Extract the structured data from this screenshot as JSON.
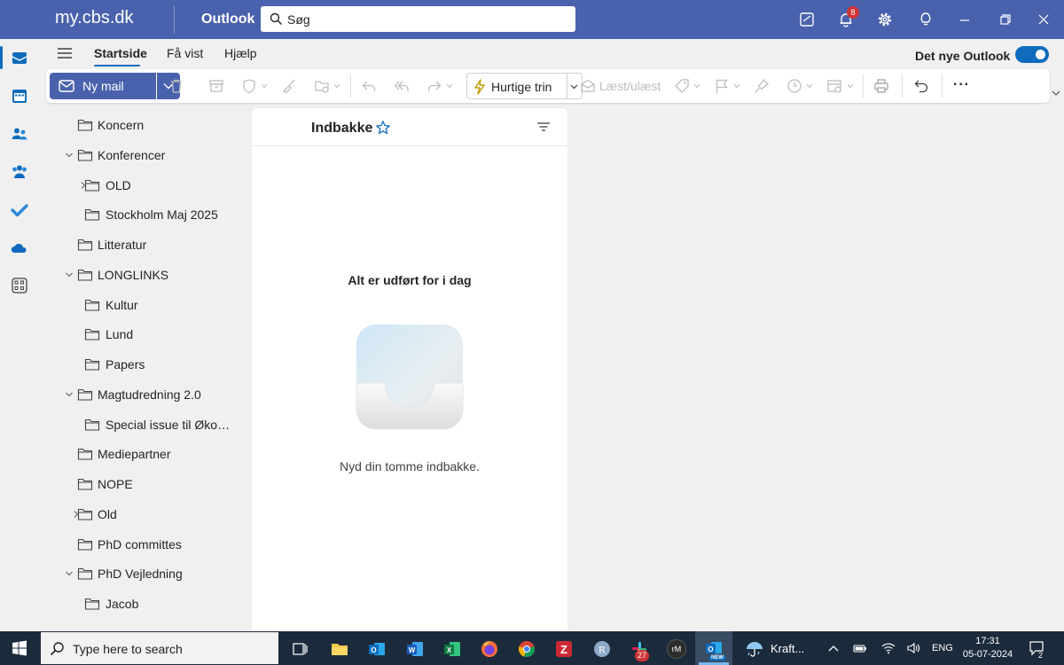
{
  "titlebar": {
    "brand": "my.cbs.dk",
    "app_name": "Outlook",
    "search_placeholder": "Søg",
    "notification_count": "8",
    "accent_color": "#4a62ad"
  },
  "rail": {
    "items": [
      "mail-icon",
      "calendar-icon",
      "people-icon",
      "groups-icon",
      "todo-icon",
      "onedrive-icon",
      "apps-icon"
    ]
  },
  "tabs": {
    "items": [
      "Startside",
      "Få vist",
      "Hjælp"
    ],
    "active": "Startside",
    "new_outlook_label": "Det nye Outlook",
    "new_outlook_enabled": true
  },
  "ribbon": {
    "new_mail_label": "Ny mail",
    "quick_steps_label": "Hurtige trin",
    "read_unread_label": "Læst/ulæst",
    "more_label": "···"
  },
  "folders": [
    {
      "label": "Koncern",
      "level": 0,
      "expander": "none"
    },
    {
      "label": "Konferencer",
      "level": 0,
      "expander": "expanded"
    },
    {
      "label": "OLD",
      "level": 1,
      "expander": "collapsed"
    },
    {
      "label": "Stockholm Maj 2025",
      "level": 1,
      "expander": "none"
    },
    {
      "label": "Litteratur",
      "level": 0,
      "expander": "none"
    },
    {
      "label": "LONGLINKS",
      "level": 0,
      "expander": "expanded"
    },
    {
      "label": "Kultur",
      "level": 1,
      "expander": "none"
    },
    {
      "label": "Lund",
      "level": 1,
      "expander": "none"
    },
    {
      "label": "Papers",
      "level": 1,
      "expander": "none"
    },
    {
      "label": "Magtudredning 2.0",
      "level": 0,
      "expander": "expanded"
    },
    {
      "label": "Special issue til Økonomi og Politik",
      "level": 1,
      "expander": "none"
    },
    {
      "label": "Mediepartner",
      "level": 0,
      "expander": "none"
    },
    {
      "label": "NOPE",
      "level": 0,
      "expander": "none"
    },
    {
      "label": "Old",
      "level": 0,
      "expander": "collapsed"
    },
    {
      "label": "PhD committes",
      "level": 0,
      "expander": "none"
    },
    {
      "label": "PhD Vejledning",
      "level": 0,
      "expander": "expanded"
    },
    {
      "label": "Jacob",
      "level": 1,
      "expander": "none"
    }
  ],
  "message_list": {
    "title": "Indbakke",
    "empty_title": "Alt er udført for i dag",
    "empty_subtitle": "Nyd din tomme indbakke."
  },
  "taskbar": {
    "search_placeholder": "Type here to search",
    "apps": [
      "task-view-icon",
      "file-explorer-icon",
      "outlook-classic-icon",
      "word-icon",
      "excel-icon",
      "firefox-icon",
      "chrome-icon",
      "zotero-icon",
      "r-icon",
      "slack-icon",
      "remarkable-icon",
      "outlook-new-icon"
    ],
    "slack_badge": "27",
    "remarkable_label": "rM",
    "outlook_new_badge": "NEW",
    "weather_label": "Kraft...",
    "language": "ENG",
    "time": "17:31",
    "date": "05-07-2024",
    "notification_count": "2"
  }
}
